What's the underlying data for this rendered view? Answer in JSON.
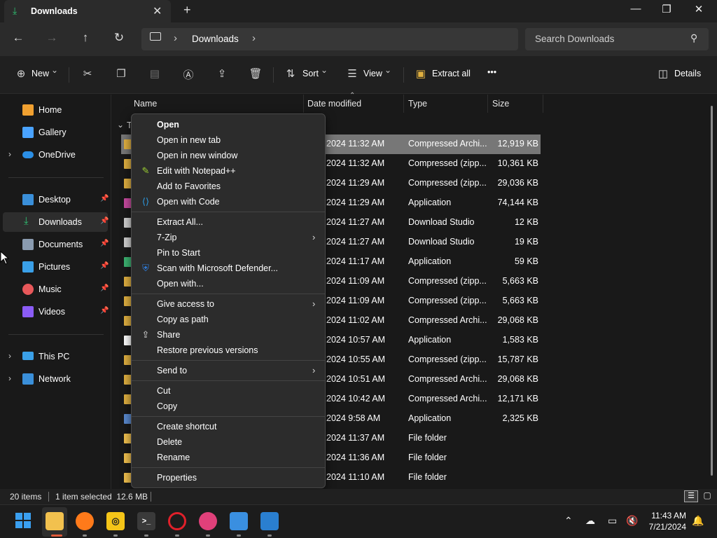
{
  "tab": {
    "title": "Downloads",
    "close": "✕",
    "new_tab": "+"
  },
  "window_controls": {
    "minimize": "—",
    "maximize": "❐",
    "close": "✕"
  },
  "address": {
    "segment": "Downloads",
    "separator": "›",
    "search_placeholder": "Search Downloads"
  },
  "toolbar": {
    "new_label": "New",
    "sort_label": "Sort",
    "view_label": "View",
    "extract_label": "Extract all",
    "more_label": "•••",
    "details_label": "Details",
    "caret": "⌄"
  },
  "sidebar": {
    "items": [
      {
        "label": "Home",
        "icon": "home-icon",
        "color": "#f0a030",
        "pinned": false,
        "chevron": false
      },
      {
        "label": "Gallery",
        "icon": "gallery-icon",
        "color": "#4aa3ff",
        "pinned": false,
        "chevron": false
      },
      {
        "label": "OneDrive",
        "icon": "cloud-icon",
        "color": "#2b8fe6",
        "pinned": false,
        "chevron": true
      },
      {
        "label": "Desktop",
        "icon": "desktop-icon",
        "color": "#3a8fd9",
        "pinned": true,
        "chevron": false
      },
      {
        "label": "Downloads",
        "icon": "download-icon",
        "color": "#2fbf71",
        "pinned": true,
        "chevron": false,
        "selected": true
      },
      {
        "label": "Documents",
        "icon": "document-icon",
        "color": "#8a9bb0",
        "pinned": true,
        "chevron": false
      },
      {
        "label": "Pictures",
        "icon": "picture-icon",
        "color": "#3aa0e8",
        "pinned": true,
        "chevron": false
      },
      {
        "label": "Music",
        "icon": "music-icon",
        "color": "#e8585a",
        "pinned": true,
        "chevron": false
      },
      {
        "label": "Videos",
        "icon": "video-icon",
        "color": "#8b5cf6",
        "pinned": true,
        "chevron": false
      },
      {
        "label": "This PC",
        "icon": "computer-icon",
        "color": "#3aa0e8",
        "pinned": false,
        "chevron": true
      },
      {
        "label": "Network",
        "icon": "network-icon",
        "color": "#3a8fd9",
        "pinned": false,
        "chevron": true
      }
    ],
    "chevron": "›",
    "pin": "📌"
  },
  "columns": {
    "name": "Name",
    "date": "Date modified",
    "type": "Type",
    "size": "Size"
  },
  "group_label": "T",
  "files": [
    {
      "date": "2024 11:32 AM",
      "type": "Compressed Archi...",
      "size": "12,919 KB",
      "selected": true,
      "icon_color": "#e0b040"
    },
    {
      "date": "2024 11:32 AM",
      "type": "Compressed (zipp...",
      "size": "10,361 KB",
      "icon_color": "#e0b040"
    },
    {
      "date": "2024 11:29 AM",
      "type": "Compressed (zipp...",
      "size": "29,036 KB",
      "icon_color": "#e0b040"
    },
    {
      "date": "2024 11:29 AM",
      "type": "Application",
      "size": "74,144 KB",
      "icon_color": "#c84aa0"
    },
    {
      "date": "2024 11:27 AM",
      "type": "Download Studio",
      "size": "12 KB",
      "icon_color": "#d0d0d0"
    },
    {
      "date": "2024 11:27 AM",
      "type": "Download Studio",
      "size": "19 KB",
      "icon_color": "#d0d0d0"
    },
    {
      "date": "2024 11:17 AM",
      "type": "Application",
      "size": "59 KB",
      "icon_color": "#3cb371"
    },
    {
      "date": "2024 11:09 AM",
      "type": "Compressed (zipp...",
      "size": "5,663 KB",
      "icon_color": "#e0b040"
    },
    {
      "date": "2024 11:09 AM",
      "type": "Compressed (zipp...",
      "size": "5,663 KB",
      "icon_color": "#e0b040"
    },
    {
      "date": "2024 11:02 AM",
      "type": "Compressed Archi...",
      "size": "29,068 KB",
      "icon_color": "#e0b040"
    },
    {
      "date": "2024 10:57 AM",
      "type": "Application",
      "size": "1,583 KB",
      "icon_color": "#ffffff"
    },
    {
      "date": "2024 10:55 AM",
      "type": "Compressed (zipp...",
      "size": "15,787 KB",
      "icon_color": "#e0b040"
    },
    {
      "date": "2024 10:51 AM",
      "type": "Compressed Archi...",
      "size": "29,068 KB",
      "icon_color": "#e0b040"
    },
    {
      "date": "2024 10:42 AM",
      "type": "Compressed Archi...",
      "size": "12,171 KB",
      "icon_color": "#e0b040"
    },
    {
      "date": "2024 9:58 AM",
      "type": "Application",
      "size": "2,325 KB",
      "icon_color": "#5a8ad0"
    },
    {
      "date": "2024 11:37 AM",
      "type": "File folder",
      "size": "",
      "icon_color": "#f2c14e"
    },
    {
      "date": "2024 11:36 AM",
      "type": "File folder",
      "size": "",
      "icon_color": "#f2c14e"
    },
    {
      "date": "2024 11:10 AM",
      "type": "File folder",
      "size": "",
      "icon_color": "#f2c14e"
    }
  ],
  "context_menu": {
    "groups": [
      [
        {
          "label": "Open",
          "bold": true
        },
        {
          "label": "Open in new tab"
        },
        {
          "label": "Open in new window"
        },
        {
          "label": "Edit with Notepad++",
          "icon": "notepad-plus-plus-icon",
          "icon_color": "#9acd32"
        },
        {
          "label": "Add to Favorites"
        },
        {
          "label": "Open with Code",
          "icon": "vscode-icon",
          "icon_color": "#2d9ee6"
        }
      ],
      [
        {
          "label": "Extract All..."
        },
        {
          "label": "7-Zip",
          "submenu": true
        },
        {
          "label": "Pin to Start"
        },
        {
          "label": "Scan with Microsoft Defender...",
          "icon": "defender-shield-icon",
          "icon_color": "#2f7fe0"
        },
        {
          "label": "Open with..."
        }
      ],
      [
        {
          "label": "Give access to",
          "submenu": true
        },
        {
          "label": "Copy as path"
        },
        {
          "label": "Share",
          "icon": "share-icon",
          "icon_color": "#dddddd"
        },
        {
          "label": "Restore previous versions"
        }
      ],
      [
        {
          "label": "Send to",
          "submenu": true
        }
      ],
      [
        {
          "label": "Cut"
        },
        {
          "label": "Copy"
        }
      ],
      [
        {
          "label": "Create shortcut"
        },
        {
          "label": "Delete"
        },
        {
          "label": "Rename"
        }
      ],
      [
        {
          "label": "Properties"
        }
      ]
    ],
    "submenu_arrow": "›"
  },
  "status": {
    "items": "20 items",
    "selection": "1 item selected  12.6 MB"
  },
  "clock": {
    "time": "11:43 AM",
    "date": "7/21/2024"
  },
  "taskbar": {
    "apps": [
      {
        "name": "start-button",
        "color": "#3a9ff0"
      },
      {
        "name": "file-explorer-app",
        "color": "#f2c14e",
        "active": true
      },
      {
        "name": "firefox-app",
        "color": "#ff7a1a"
      },
      {
        "name": "pointer-app",
        "color": "#f5c518"
      },
      {
        "name": "terminal-app",
        "color": "#3a3a3a"
      },
      {
        "name": "opera-app",
        "color": "#e0202a"
      },
      {
        "name": "download-studio-app",
        "color": "#e0407a"
      },
      {
        "name": "paint-app",
        "color": "#3a8fe0"
      },
      {
        "name": "photos-app",
        "color": "#2a7fd0"
      }
    ]
  }
}
